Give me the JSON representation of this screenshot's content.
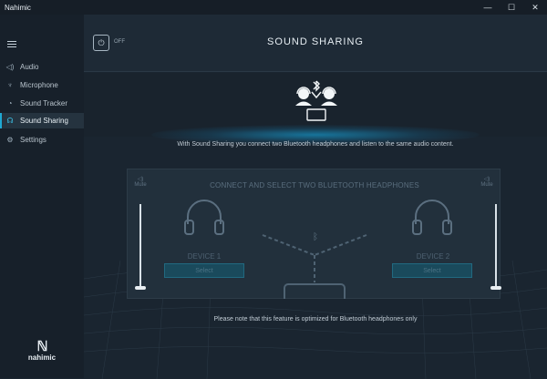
{
  "window": {
    "title": "Nahimic",
    "controls": {
      "minimize": "—",
      "maximize": "☐",
      "close": "✕"
    }
  },
  "sidebar": {
    "items": [
      {
        "label": "Audio",
        "icon": "speaker-icon",
        "active": false
      },
      {
        "label": "Microphone",
        "icon": "microphone-icon",
        "active": false
      },
      {
        "label": "Sound Tracker",
        "icon": "sound-tracker-icon",
        "active": false
      },
      {
        "label": "Sound Sharing",
        "icon": "sound-sharing-icon",
        "active": true
      },
      {
        "label": "Settings",
        "icon": "gear-icon",
        "active": false
      }
    ],
    "logo": {
      "text": "nahimic"
    }
  },
  "header": {
    "power_state": "OFF",
    "title": "SOUND SHARING"
  },
  "main": {
    "description": "With Sound Sharing you connect two Bluetooth headphones and listen to the same audio content.",
    "panel": {
      "title": "CONNECT AND SELECT TWO BLUETOOTH HEADPHONES",
      "left": {
        "mute_label": "Mute",
        "device_label": "DEVICE 1",
        "select_label": "Select",
        "volume": 0
      },
      "right": {
        "mute_label": "Mute",
        "device_label": "DEVICE 2",
        "select_label": "Select",
        "volume": 0
      }
    },
    "note": "Please note that this feature is optimized for Bluetooth headphones only"
  },
  "colors": {
    "accent": "#1fa8d2",
    "background": "#1a2530",
    "select_button": "#1a4a5c"
  }
}
